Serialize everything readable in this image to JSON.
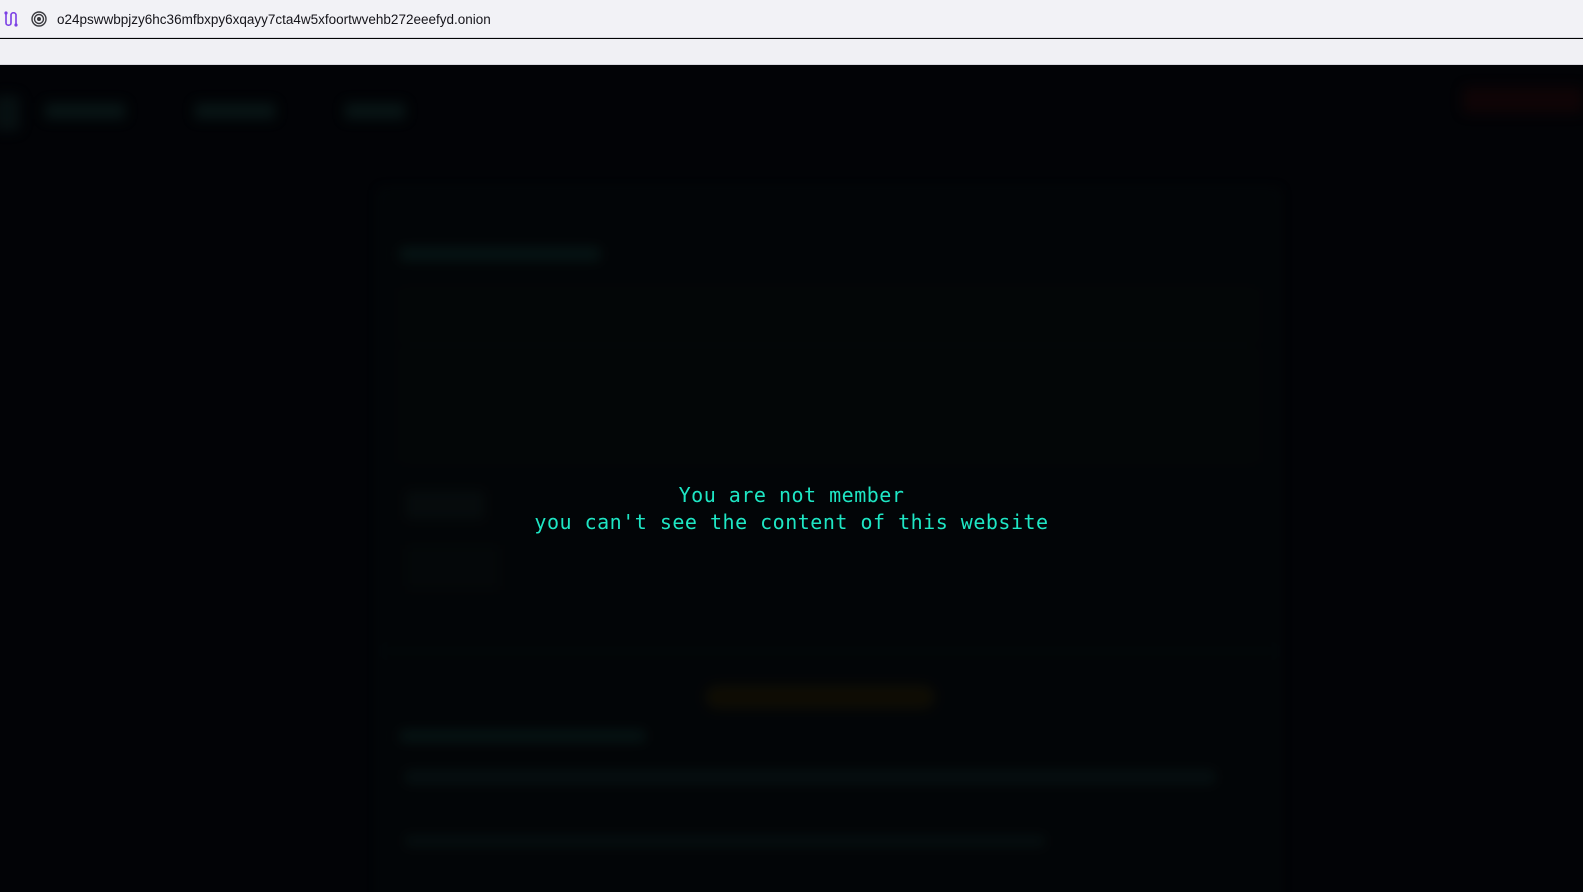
{
  "browser": {
    "url": "o24pswwbpjzy6hc36mfbxpy6xqayy7cta4w5xfoortwvehb272eeefyd.onion",
    "route_icon": "tor-circuit-icon",
    "site_icon": "onion-icon"
  },
  "message": {
    "line1": "You are not member",
    "line2": "you can't see the content of this website"
  },
  "colors": {
    "message": "#1ee6c4",
    "background": "#020306"
  }
}
